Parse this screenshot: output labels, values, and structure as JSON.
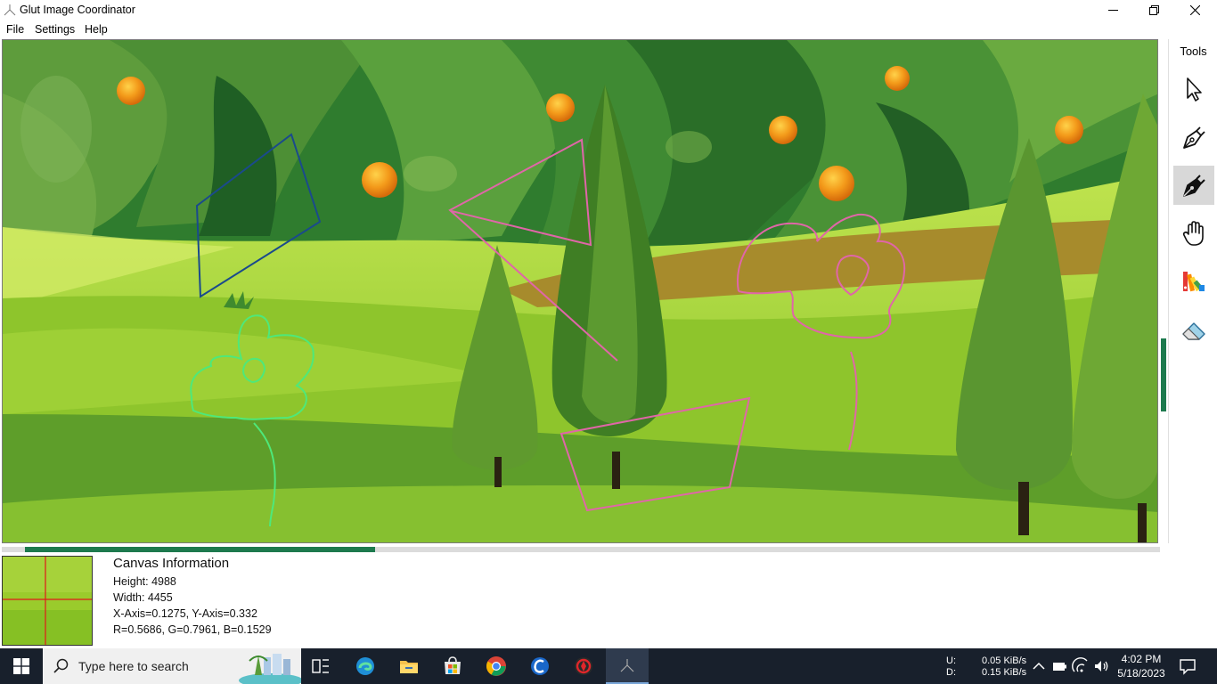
{
  "window": {
    "title": "Glut Image Coordinator",
    "app_icon": "glut-tripod-icon"
  },
  "menu": {
    "items": [
      {
        "label": "File"
      },
      {
        "label": "Settings"
      },
      {
        "label": "Help"
      }
    ]
  },
  "tools": {
    "title": "Tools",
    "items": [
      {
        "name": "pointer-tool",
        "icon": "arrow-cursor-icon",
        "active": false
      },
      {
        "name": "pen-outline-tool",
        "icon": "pen-nib-outline-icon",
        "active": false
      },
      {
        "name": "pen-filled-tool",
        "icon": "pen-nib-filled-icon",
        "active": true
      },
      {
        "name": "hand-tool",
        "icon": "hand-icon",
        "active": false
      },
      {
        "name": "color-palette-tool",
        "icon": "color-swatches-icon",
        "active": false
      },
      {
        "name": "eraser-tool",
        "icon": "eraser-icon",
        "active": false
      }
    ]
  },
  "scroll": {
    "horizontal_position": 0.02,
    "horizontal_visible_fraction": 0.3,
    "vertical_position": 0.6,
    "vertical_visible_fraction": 0.15
  },
  "canvas_info": {
    "title": "Canvas Information",
    "height_line": "Height: 4988",
    "width_line": "Width: 4455",
    "axis_line": "X-Axis=0.1275, Y-Axis=0.332",
    "rgb_line": "R=0.5686, G=0.7961, B=0.1529"
  },
  "colors": {
    "stroke_blue": "#1a4a8c",
    "stroke_pink": "#e066a8",
    "stroke_green": "#4ee87a",
    "scroll_thumb": "#1d7a4e",
    "crosshair": "#e01818",
    "sampled_color": "#91cb27"
  },
  "taskbar": {
    "search_placeholder": "Type here to search",
    "apps": [
      {
        "name": "task-view-icon"
      },
      {
        "name": "edge-browser-icon"
      },
      {
        "name": "file-explorer-icon"
      },
      {
        "name": "microsoft-store-icon"
      },
      {
        "name": "chrome-browser-icon"
      },
      {
        "name": "ccleaner-icon"
      },
      {
        "name": "red-app-icon"
      },
      {
        "name": "glut-app-icon",
        "active": true
      }
    ],
    "net_upload_label": "U:",
    "net_download_label": "D:",
    "net_upload_value": "0.05 KiB/s",
    "net_download_value": "0.15 KiB/s",
    "time": "4:02 PM",
    "date": "5/18/2023"
  }
}
